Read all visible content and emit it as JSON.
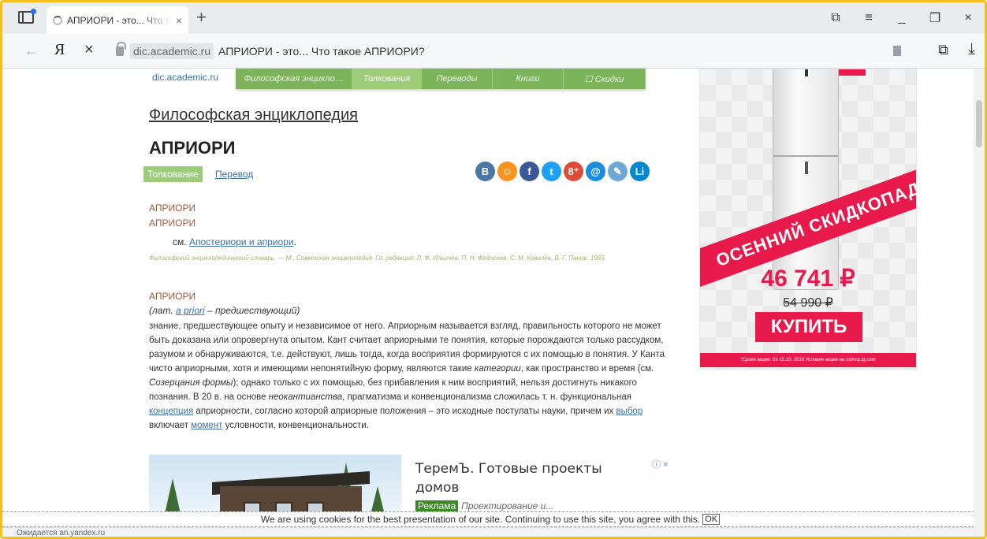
{
  "browser": {
    "tab_title": "АПРИОРИ - это... Что та",
    "tab_close": "×",
    "new_tab": "+",
    "url_domain": "dic.academic.ru",
    "url_title": "АПРИОРИ - это... Что такое АПРИОРИ?",
    "nav_back": "←",
    "nav_ya": "Я",
    "nav_stop": "×",
    "win_icons": [
      "⧉",
      "≡",
      "_",
      "❐",
      "×"
    ],
    "ext_icon": "⧉",
    "download_icon": "⤓"
  },
  "site": {
    "logo": "dic.academic.ru",
    "nav": [
      {
        "label": "Философская энцикло…",
        "active": false
      },
      {
        "label": "Толкования",
        "active": true
      },
      {
        "label": "Переводы",
        "active": false
      },
      {
        "label": "Книги",
        "active": false
      },
      {
        "label": "☐ Скидки",
        "active": false
      }
    ]
  },
  "article": {
    "dictionary_title": "Философская энциклопедия",
    "word": "АПРИОРИ",
    "badge": "Толкование",
    "translate_link": "Перевод",
    "social": [
      {
        "name": "vk-icon",
        "glyph": "В",
        "color": "#4a76a8"
      },
      {
        "name": "ok-icon",
        "glyph": "☺",
        "color": "#f7931e"
      },
      {
        "name": "facebook-icon",
        "glyph": "f",
        "color": "#3b5998"
      },
      {
        "name": "twitter-icon",
        "glyph": "t",
        "color": "#1da1f2"
      },
      {
        "name": "googleplus-icon",
        "glyph": "8⁺",
        "color": "#dd4b39"
      },
      {
        "name": "mailru-icon",
        "glyph": "@",
        "color": "#168de2"
      },
      {
        "name": "livejournal-icon",
        "glyph": "✎",
        "color": "#6ea9d6"
      },
      {
        "name": "liveinternet-icon",
        "glyph": "Li",
        "color": "#0088cc"
      }
    ],
    "entry1_head1": "АПРИОРИ",
    "entry1_head2": "АПРИОРИ",
    "see_prefix": "см.",
    "see_link": "Апостериори и априори",
    "see_suffix": ".",
    "source": "Философский энциклопедический словарь. — М.: Советская энциклопедия. Гл. редакция: Л. Ф. Ильичёв, П. Н. Федосеев, С. М. Ковалёв, В. Г. Панов. 1983.",
    "entry2_head": "АПРИОРИ",
    "lat_prefix": "(лат. ",
    "lat_link": "a priori",
    "lat_suffix": " – предшествующий)",
    "p1": "знание, предшествующее опыту и независимое от него. Априорным называется взгляд, правильность которого не может быть доказана или опровергнута опытом. Кант считает априорными те понятия, которые порождаются только рассудком, разумом и обнаруживаются, т.е. действуют, лишь тогда, когда восприятия формируются с их помощью в понятия. У Канта чисто априорными, хотя и имеющими непонятийную форму, являются такие ",
    "p1_em1": "категории",
    "p1_b": ", как пространство и время (см. ",
    "p1_em2": "Созерцания формы",
    "p1_c": "); однако только с их помощью, без прибавления к ним восприятий, нельзя достигнуть никакого познания. В 20 в. на основе ",
    "p1_em3": "неокантианства",
    "p1_d": ", прагматизма и конвенционализма сложилась т. н. функциональная ",
    "link_concept": "концепция",
    "p1_e": " априорности, согласно которой априорные положения – это исходные постулаты науки, причем их ",
    "link_choice": "выбор",
    "p1_f": " включает ",
    "link_moment": "момент",
    "p1_g": " условности, конвенциональности."
  },
  "ad_banner": {
    "ribbon": "ОСЕННИЙ СКИДКОПАД",
    "price_new": "46 741 ₽",
    "price_old": "54 990 ₽",
    "buy": "КУПИТЬ",
    "legal": "*Сроки акции: 01-15.10. 2019 Условия акции на rushop.lg.com"
  },
  "ad_inline": {
    "title": "ТеремЪ. Готовые проекты домов",
    "marker": "ⓘ ×",
    "tag": "Реклама",
    "sub": "Проектирование и..."
  },
  "cookie": {
    "text": "We are using cookies for the best presentation of our site. Continuing to use this site, you agree with this.",
    "ok": "OK"
  },
  "status": "Ожидается an.yandex.ru"
}
